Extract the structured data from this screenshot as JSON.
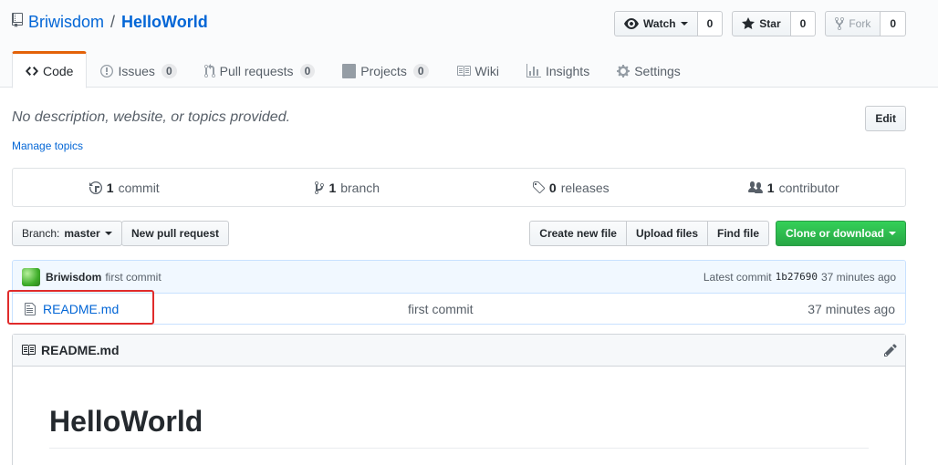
{
  "repo": {
    "owner": "Briwisdom",
    "separator": "/",
    "name": "HelloWorld"
  },
  "actions": {
    "watch": {
      "label": "Watch",
      "count": "0"
    },
    "star": {
      "label": "Star",
      "count": "0"
    },
    "fork": {
      "label": "Fork",
      "count": "0"
    }
  },
  "nav": {
    "code": "Code",
    "issues": {
      "label": "Issues",
      "count": "0"
    },
    "pulls": {
      "label": "Pull requests",
      "count": "0"
    },
    "projects": {
      "label": "Projects",
      "count": "0"
    },
    "wiki": "Wiki",
    "insights": "Insights",
    "settings": "Settings"
  },
  "description": "No description, website, or topics provided.",
  "manage_topics": "Manage topics",
  "edit_label": "Edit",
  "summary": {
    "commits": {
      "count": "1",
      "label": "commit"
    },
    "branches": {
      "count": "1",
      "label": "branch"
    },
    "releases": {
      "count": "0",
      "label": "releases"
    },
    "contributors": {
      "count": "1",
      "label": "contributor"
    }
  },
  "filenav": {
    "branch_prefix": "Branch:",
    "branch": "master",
    "new_pr": "New pull request",
    "create_file": "Create new file",
    "upload_files": "Upload files",
    "find_file": "Find file",
    "clone": "Clone or download"
  },
  "commit": {
    "author": "Briwisdom",
    "message": "first commit",
    "latest_label": "Latest commit",
    "sha": "1b27690",
    "age": "37 minutes ago"
  },
  "files": [
    {
      "name": "README.md",
      "message": "first commit",
      "age": "37 minutes ago"
    }
  ],
  "readme": {
    "title": "README.md",
    "heading": "HelloWorld"
  },
  "colors": {
    "accent": "#0366d6",
    "highlight": "#e02b2b",
    "tab_active": "#e36209",
    "green": "#28a745"
  }
}
